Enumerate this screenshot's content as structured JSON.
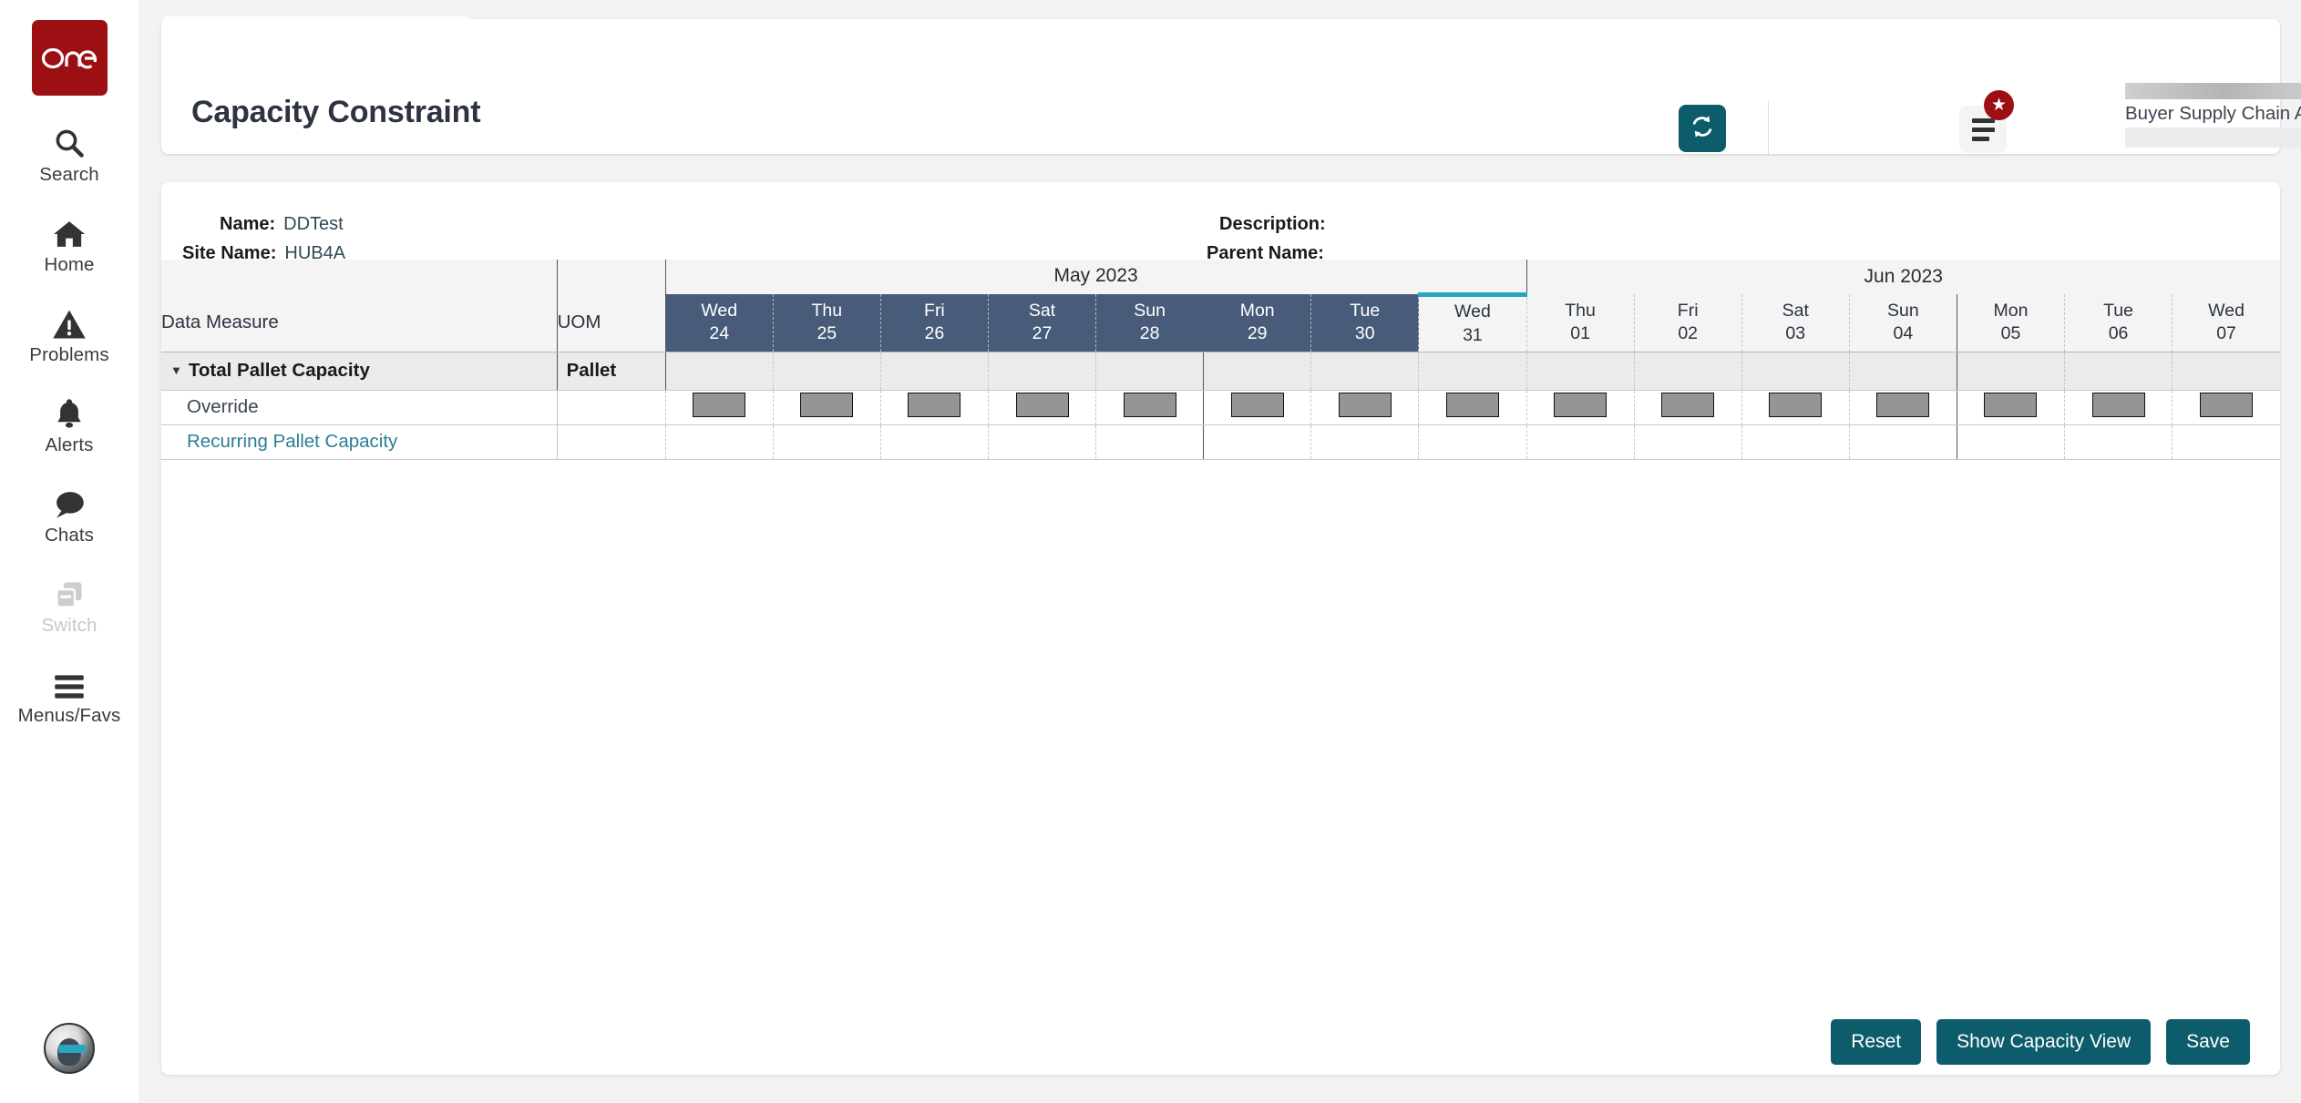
{
  "sidebar": {
    "logo_text": "one",
    "items": [
      {
        "label": "Search",
        "icon": "search-icon",
        "disabled": false
      },
      {
        "label": "Home",
        "icon": "home-icon",
        "disabled": false
      },
      {
        "label": "Problems",
        "icon": "warning-icon",
        "disabled": false
      },
      {
        "label": "Alerts",
        "icon": "bell-icon",
        "disabled": false
      },
      {
        "label": "Chats",
        "icon": "chat-icon",
        "disabled": false
      },
      {
        "label": "Switch",
        "icon": "switch-icon",
        "disabled": true
      },
      {
        "label": "Menus/Favs",
        "icon": "hamburger-icon",
        "disabled": false
      }
    ],
    "avatar": "user-avatar"
  },
  "tab": {
    "label": "Capacity Constraint"
  },
  "header": {
    "title": "Capacity Constraint",
    "refresh_icon": "refresh-icon",
    "menu_icon": "list-menu-icon",
    "badge_icon": "star-badge",
    "badge_glyph": "★",
    "user_role": "Buyer Supply Chain Admin",
    "caret_glyph": "❯"
  },
  "info": {
    "name_label": "Name:",
    "name_value": "DDTest",
    "site_label": "Site Name:",
    "site_value": "HUB4A",
    "description_label": "Description:",
    "description_value": "",
    "parent_label": "Parent Name:",
    "parent_value": ""
  },
  "grid": {
    "col_label": "Data Measure",
    "col_uom": "UOM",
    "months": [
      {
        "label": "May 2023",
        "span": 8
      },
      {
        "label": "Jun 2023",
        "span": 7
      }
    ],
    "days": [
      {
        "dow": "Wed",
        "dom": "24",
        "state": "past",
        "week_start": false
      },
      {
        "dow": "Thu",
        "dom": "25",
        "state": "past",
        "week_start": false
      },
      {
        "dow": "Fri",
        "dom": "26",
        "state": "past",
        "week_start": false
      },
      {
        "dow": "Sat",
        "dom": "27",
        "state": "past",
        "week_start": false
      },
      {
        "dow": "Sun",
        "dom": "28",
        "state": "past",
        "week_start": false
      },
      {
        "dow": "Mon",
        "dom": "29",
        "state": "past",
        "week_start": true
      },
      {
        "dow": "Tue",
        "dom": "30",
        "state": "past",
        "week_start": false
      },
      {
        "dow": "Wed",
        "dom": "31",
        "state": "today",
        "week_start": false
      },
      {
        "dow": "Thu",
        "dom": "01",
        "state": "future",
        "week_start": false
      },
      {
        "dow": "Fri",
        "dom": "02",
        "state": "future",
        "week_start": false
      },
      {
        "dow": "Sat",
        "dom": "03",
        "state": "future",
        "week_start": false
      },
      {
        "dow": "Sun",
        "dom": "04",
        "state": "future",
        "week_start": false
      },
      {
        "dow": "Mon",
        "dom": "05",
        "state": "future",
        "week_start": true
      },
      {
        "dow": "Tue",
        "dom": "06",
        "state": "future",
        "week_start": false
      },
      {
        "dow": "Wed",
        "dom": "07",
        "state": "future",
        "week_start": false
      }
    ],
    "rows": [
      {
        "kind": "group",
        "label": "Total Pallet Capacity",
        "uom": "Pallet",
        "link": false,
        "cells": "empty"
      },
      {
        "kind": "data",
        "label": "Override",
        "uom": "",
        "link": false,
        "cells": "override-box"
      },
      {
        "kind": "data",
        "label": "Recurring Pallet Capacity",
        "uom": "",
        "link": true,
        "cells": "empty"
      }
    ]
  },
  "footer": {
    "buttons": [
      {
        "label": "Reset",
        "name": "reset-button"
      },
      {
        "label": "Show Capacity View",
        "name": "show-capacity-view-button"
      },
      {
        "label": "Save",
        "name": "save-button"
      }
    ]
  },
  "colors": {
    "brand_red": "#9c0f13",
    "accent_teal": "#0d5c6b",
    "header_blue": "#485c7a",
    "today_cyan": "#2aa4bf",
    "link_blue": "#2b7e96"
  }
}
